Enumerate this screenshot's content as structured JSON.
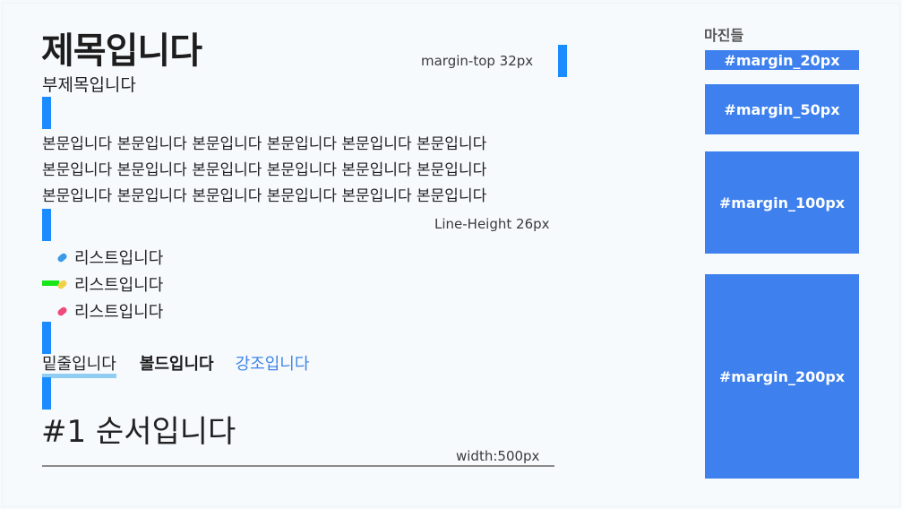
{
  "content": {
    "title": "제목입니다",
    "subtitle": "부제목입니다",
    "body_lines": [
      "본문입니다 본문입니다 본문입니다 본문입니다 본문입니다 본문입니다",
      "본문입니다 본문입니다 본문입니다 본문입니다 본문입니다 본문입니다",
      "본문입니다 본문입니다 본문입니다 본문입니다 본문입니다 본문입니다"
    ],
    "list_items": [
      {
        "label": "리스트입니다",
        "bullet_color": "#3b9ae8"
      },
      {
        "label": "리스트입니다",
        "bullet_color": "#f2d24b"
      },
      {
        "label": "리스트입니다",
        "bullet_color": "#ef4a7a"
      }
    ],
    "underline_text": "밑줄입니다",
    "bold_text": "볼드입니다",
    "emphasis_text": "강조입니다",
    "ordered_title": "#1 순서입니다"
  },
  "annotations": {
    "margin_top": "margin-top 32px",
    "line_height": "Line-Height 26px",
    "width": "width:500px"
  },
  "sidebar": {
    "title": "마진들",
    "boxes": [
      {
        "label": "#margin_20px"
      },
      {
        "label": "#margin_50px"
      },
      {
        "label": "#margin_100px"
      },
      {
        "label": "#margin_200px"
      }
    ]
  },
  "colors": {
    "marker_blue": "#1a8cff",
    "margin_box": "#3d80ee",
    "emphasis": "#3e84e8",
    "underline_highlight": "#7fc3f0",
    "green_marker": "#19e619"
  }
}
